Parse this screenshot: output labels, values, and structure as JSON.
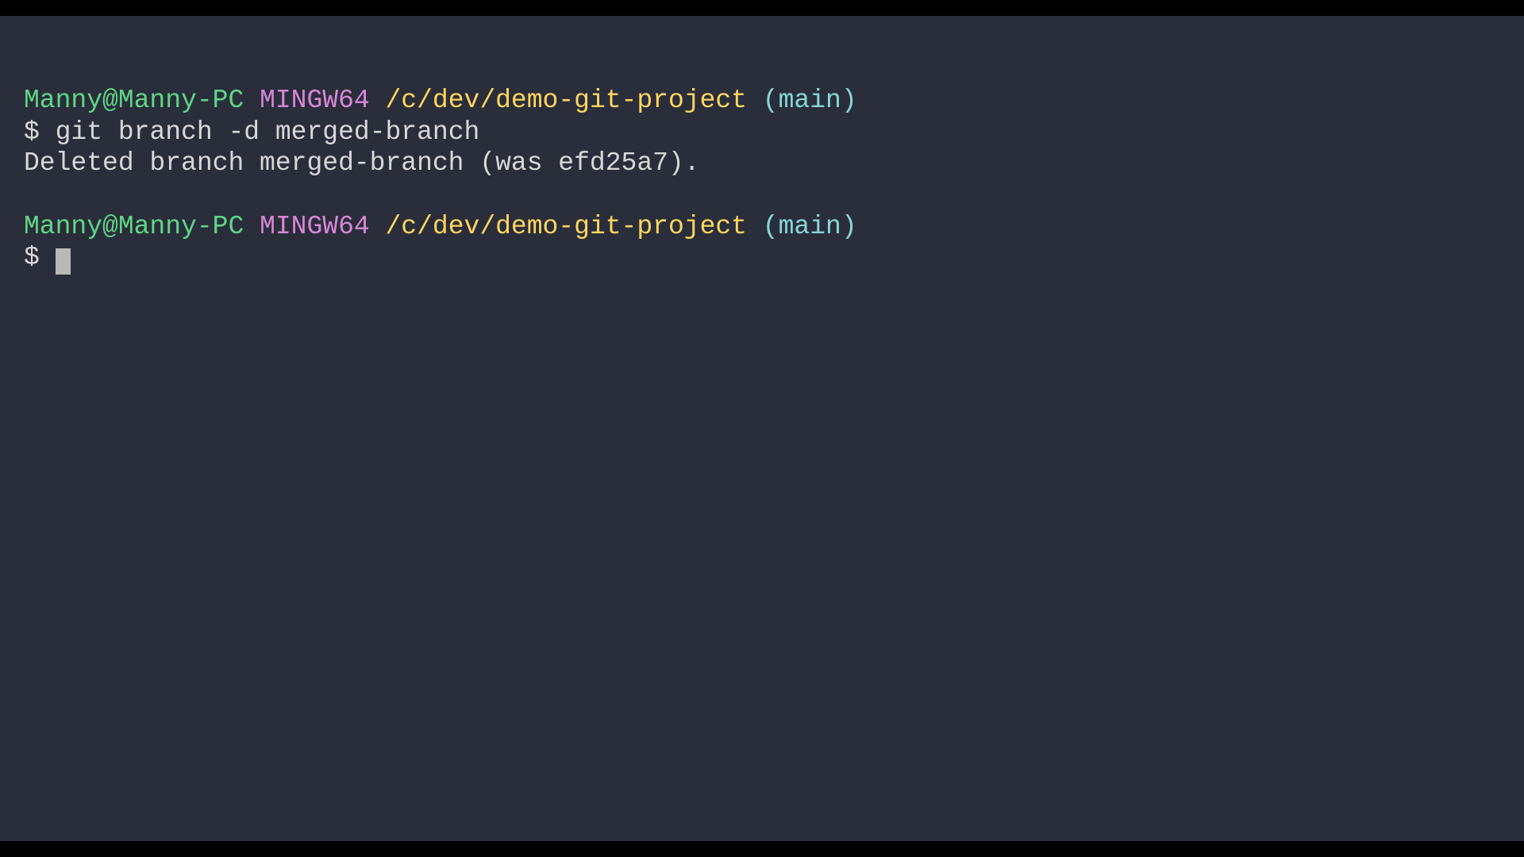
{
  "terminal": {
    "lines": [
      {
        "type": "prompt",
        "user_host": "Manny@Manny-PC",
        "mingw": "MINGW64",
        "path": "/c/dev/demo-git-project",
        "branch": "(main)"
      },
      {
        "type": "command",
        "symbol": "$",
        "text": "git branch -d merged-branch"
      },
      {
        "type": "output",
        "text": "Deleted branch merged-branch (was efd25a7)."
      },
      {
        "type": "blank"
      },
      {
        "type": "prompt",
        "user_host": "Manny@Manny-PC",
        "mingw": "MINGW64",
        "path": "/c/dev/demo-git-project",
        "branch": "(main)"
      },
      {
        "type": "command-empty",
        "symbol": "$"
      }
    ]
  }
}
